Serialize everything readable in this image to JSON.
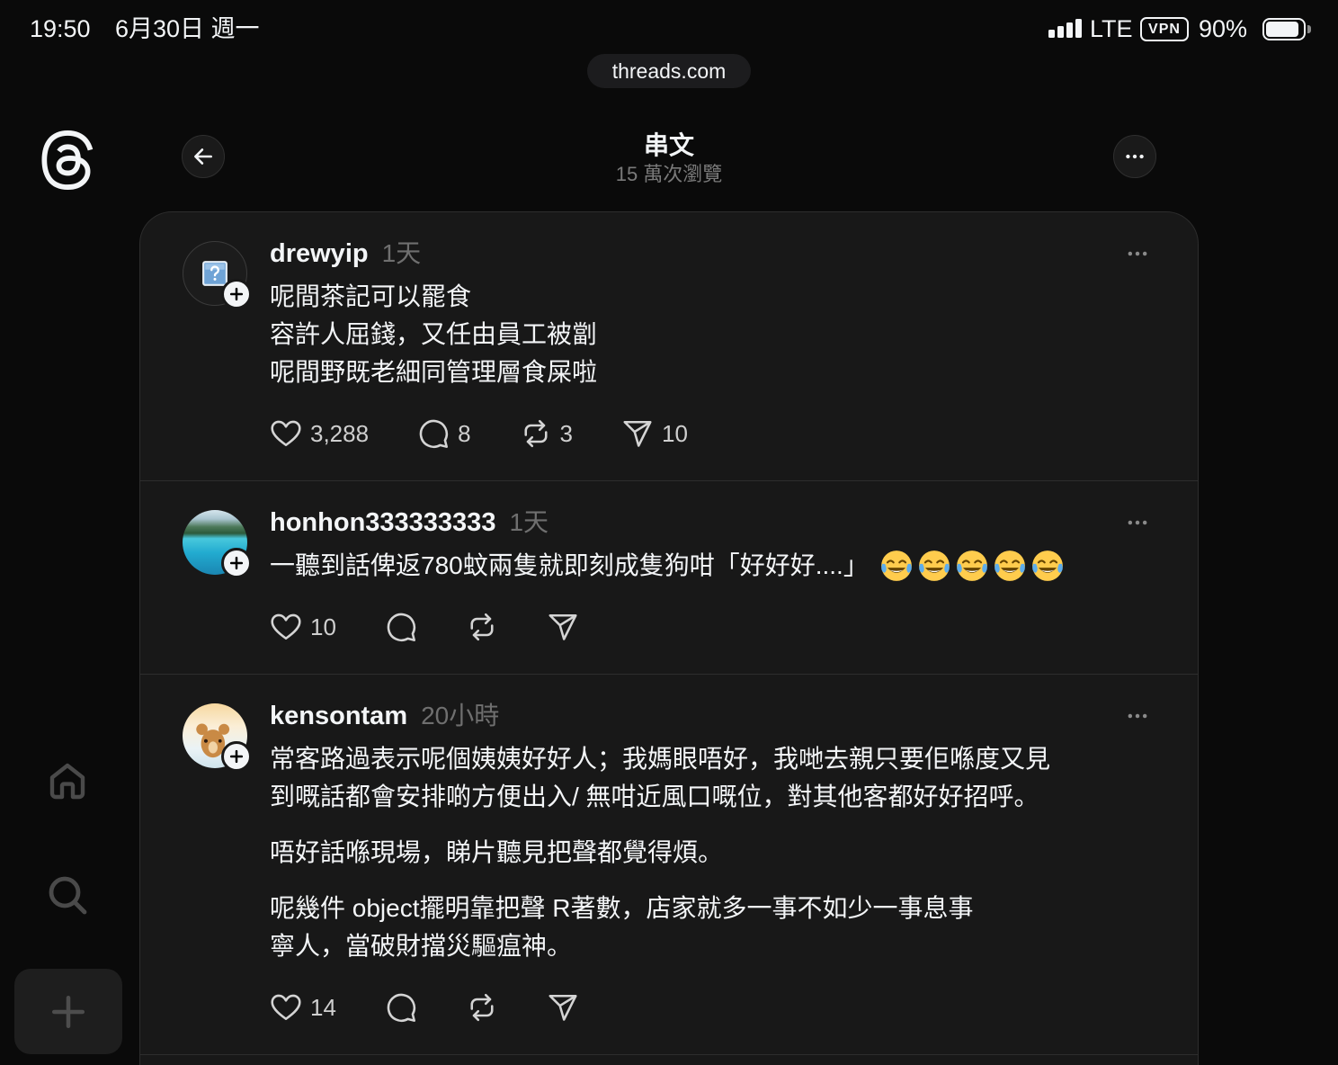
{
  "status_bar": {
    "time": "19:50",
    "date": "6月30日 週一",
    "network": "LTE",
    "vpn": "VPN",
    "battery": "90%",
    "battery_level": 0.9,
    "signal_icon": "cellular-signal-icon",
    "battery_icon": "battery-icon"
  },
  "browser": {
    "url": "threads.com"
  },
  "sidebar": {
    "logo_icon": "threads-logo-icon",
    "items": [
      {
        "name": "home",
        "icon": "home-icon"
      },
      {
        "name": "search",
        "icon": "search-icon"
      },
      {
        "name": "create",
        "icon": "plus-icon"
      }
    ]
  },
  "header": {
    "title": "串文",
    "views": "15 萬次瀏覽",
    "back_icon": "arrow-left-icon",
    "more_icon": "more-icon"
  },
  "action_icons": {
    "like": "heart-icon",
    "reply": "comment-icon",
    "repost": "repost-icon",
    "share": "send-icon"
  },
  "posts": [
    {
      "username": "drewyip",
      "time": "1天",
      "avatar": "broken-image-icon",
      "paragraphs": [
        [
          "呢間茶記可以罷食",
          "容許人屈錢，又任由員工被劏",
          "呢間野既老細同管理層食屎啦"
        ]
      ],
      "likes": "3,288",
      "replies": "8",
      "reposts": "3",
      "shares": "10"
    },
    {
      "username": "honhon333333333",
      "time": "1天",
      "avatar": "lake-photo",
      "paragraphs": [
        [
          "一聽到話俾返780蚊兩隻就即刻成隻狗咁「好好好....」"
        ]
      ],
      "emojis": [
        "face-with-tears-of-joy-icon",
        "face-with-tears-of-joy-icon",
        "face-with-tears-of-joy-icon",
        "face-with-tears-of-joy-icon",
        "face-with-tears-of-joy-icon"
      ],
      "likes": "10"
    },
    {
      "username": "kensontam",
      "time": "20小時",
      "avatar": "cartoon-bear",
      "paragraphs": [
        [
          "常客路過表示呢個姨姨好好人；我媽眼唔好，我哋去親只要佢喺度又見",
          "到嘅話都會安排啲方便出入/ 無咁近風口嘅位，對其他客都好好招呼。"
        ],
        [
          "唔好話喺現場，睇片聽見把聲都覺得煩。"
        ],
        [
          "呢幾件 object擺明靠把聲 R著數，店家就多一事不如少一事息事",
          "寧人，當破財擋災驅瘟神。"
        ]
      ],
      "likes": "14"
    }
  ],
  "colors": {
    "background": "#0a0a0a",
    "card": "#181818",
    "border": "#2d2d2d",
    "text": "#f3f5f7",
    "muted": "#6f6f6f",
    "emoji_yellow": "#ffcc4d"
  }
}
